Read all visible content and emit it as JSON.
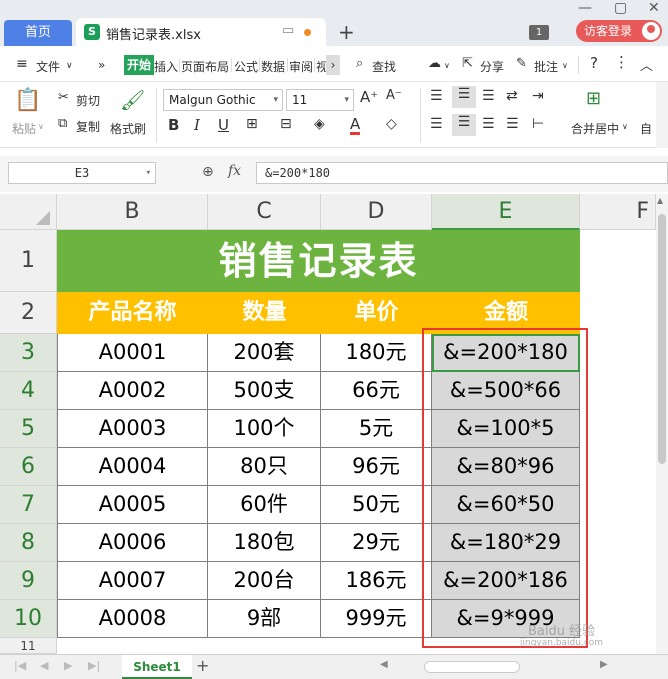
{
  "window": {
    "home_tab": "首页",
    "file_tab": "销售记录表.xlsx",
    "file_icon_letter": "S",
    "new_tab": "+",
    "visitor_login": "访客登录",
    "badge": "1"
  },
  "menu": {
    "file": "文件",
    "start": "开始",
    "insert": "插入",
    "page_layout": "页面布局",
    "formula": "公式",
    "data": "数据",
    "review": "审阅",
    "view_cut": "视",
    "search": "查找",
    "share": "分享",
    "annotate": "批注",
    "help": "?"
  },
  "ribbon": {
    "paste": "粘贴",
    "cut": "剪切",
    "copy": "复制",
    "format_painter": "格式刷",
    "font_name": "Malgun Gothic",
    "font_size": "11",
    "merge_center": "合并居中",
    "auto_wrap": "自"
  },
  "formula_bar": {
    "cell_ref": "E3",
    "fx": "fx",
    "formula": "&=200*180"
  },
  "columns": [
    "B",
    "C",
    "D",
    "E",
    "F"
  ],
  "rows": [
    "1",
    "2",
    "3",
    "4",
    "5",
    "6",
    "7",
    "8",
    "9",
    "10",
    "11"
  ],
  "sheet": {
    "title": "销售记录表",
    "headers": [
      "产品名称",
      "数量",
      "单价",
      "金额"
    ],
    "data": [
      [
        "A0001",
        "200套",
        "180元",
        "&=200*180"
      ],
      [
        "A0002",
        "500支",
        "66元",
        "&=500*66"
      ],
      [
        "A0003",
        "100个",
        "5元",
        "&=100*5"
      ],
      [
        "A0004",
        "80只",
        "96元",
        "&=80*96"
      ],
      [
        "A0005",
        "60件",
        "50元",
        "&=60*50"
      ],
      [
        "A0006",
        "180包",
        "29元",
        "&=180*29"
      ],
      [
        "A0007",
        "200台",
        "186元",
        "&=200*186"
      ],
      [
        "A0008",
        "9部",
        "999元",
        "&=9*999"
      ]
    ]
  },
  "sheet_tabs": [
    "Sheet1"
  ],
  "watermark": "Baidu 经验",
  "watermark_url": "jingyan.baidu.com",
  "colors": {
    "title_green": "#6db33f",
    "header_orange": "#ffc000",
    "selection_green": "#3c9a42",
    "annotation_red": "#e53935"
  }
}
